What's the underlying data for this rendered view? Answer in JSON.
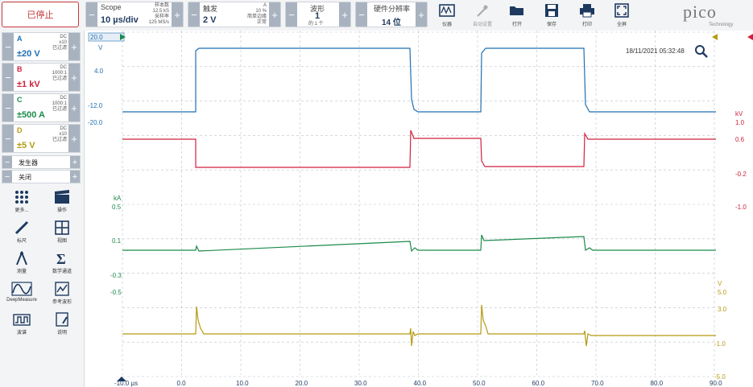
{
  "toolbar": {
    "stop_label": "已停止",
    "scope": {
      "title": "Scope",
      "value": "10 µs/div",
      "info1": "样本数",
      "info2": "12.5 kS",
      "info3": "采样率",
      "info4": "125 MS/s"
    },
    "trigger": {
      "title": "触发",
      "value": "2 V",
      "info1": "A",
      "info2": "10 %",
      "info3": "简单边缘",
      "info4": "正常"
    },
    "waveform": {
      "title": "波形",
      "value": "1",
      "sub": "的 1 个"
    },
    "hwres": {
      "title": "硬件分辨率",
      "value": "14 位"
    },
    "tools": [
      {
        "label": "仪器",
        "icon": "instrument-icon"
      },
      {
        "label": "自动设置",
        "icon": "auto-setup-icon"
      },
      {
        "label": "打开",
        "icon": "folder-open-icon"
      },
      {
        "label": "保存",
        "icon": "save-icon"
      },
      {
        "label": "打印",
        "icon": "print-icon"
      },
      {
        "label": "全屏",
        "icon": "fullscreen-icon"
      }
    ],
    "logo": "pico",
    "logo_sub": "Technology"
  },
  "channels": [
    {
      "letter": "A",
      "range": "±20 V",
      "info1": "DC",
      "info2": "x10",
      "info3": "已过滤",
      "color": "#1f6fb2"
    },
    {
      "letter": "B",
      "range": "±1 kV",
      "info1": "DC",
      "info2": "1000:1",
      "info3": "已过滤",
      "color": "#d0223f"
    },
    {
      "letter": "C",
      "range": "±500 A",
      "info1": "DC",
      "info2": "1000:1",
      "info3": "已过滤",
      "color": "#1b8a4b"
    },
    {
      "letter": "D",
      "range": "±5 V",
      "info1": "DC",
      "info2": "x10",
      "info3": "已过滤",
      "color": "#b59a12"
    }
  ],
  "generator_label": "发生器",
  "off_label": "关闭",
  "side_tools": [
    {
      "label": "更多...",
      "icon": "more-icon"
    },
    {
      "label": "操作",
      "icon": "actions-icon"
    },
    {
      "label": "标尺",
      "icon": "ruler-icon"
    },
    {
      "label": "视图",
      "icon": "view-icon"
    },
    {
      "label": "测量",
      "icon": "measure-icon"
    },
    {
      "label": "数学通道",
      "icon": "math-icon"
    },
    {
      "label": "DeepMeasure",
      "icon": "deepmeasure-icon"
    },
    {
      "label": "参考波形",
      "icon": "reference-icon"
    },
    {
      "label": "波谱",
      "icon": "spectrum-icon"
    },
    {
      "label": "说明",
      "icon": "notes-icon"
    }
  ],
  "plot": {
    "timestamp": "18/11/2021 05:32:48",
    "x_ticks": [
      "-10.0 µs",
      "0.0",
      "10.0",
      "20.0",
      "30.0",
      "40.0",
      "50.0",
      "60.0",
      "70.0",
      "80.0",
      "90.0"
    ],
    "a_unit": "V",
    "a_top": "20.0",
    "a_ticks": [
      "4.0",
      "-12.0",
      "-20.0"
    ],
    "b_unit": "kV",
    "b_ticks": [
      "1.0",
      "0.6",
      "-0.2",
      "-1.0"
    ],
    "c_unit": "kA",
    "c_ticks": [
      "0.5",
      "0.1",
      "-0.3",
      "-0.5"
    ],
    "d_unit": "V",
    "d_ticks": [
      "5.0",
      "3.0",
      "-1.0",
      "-5.0"
    ]
  }
}
